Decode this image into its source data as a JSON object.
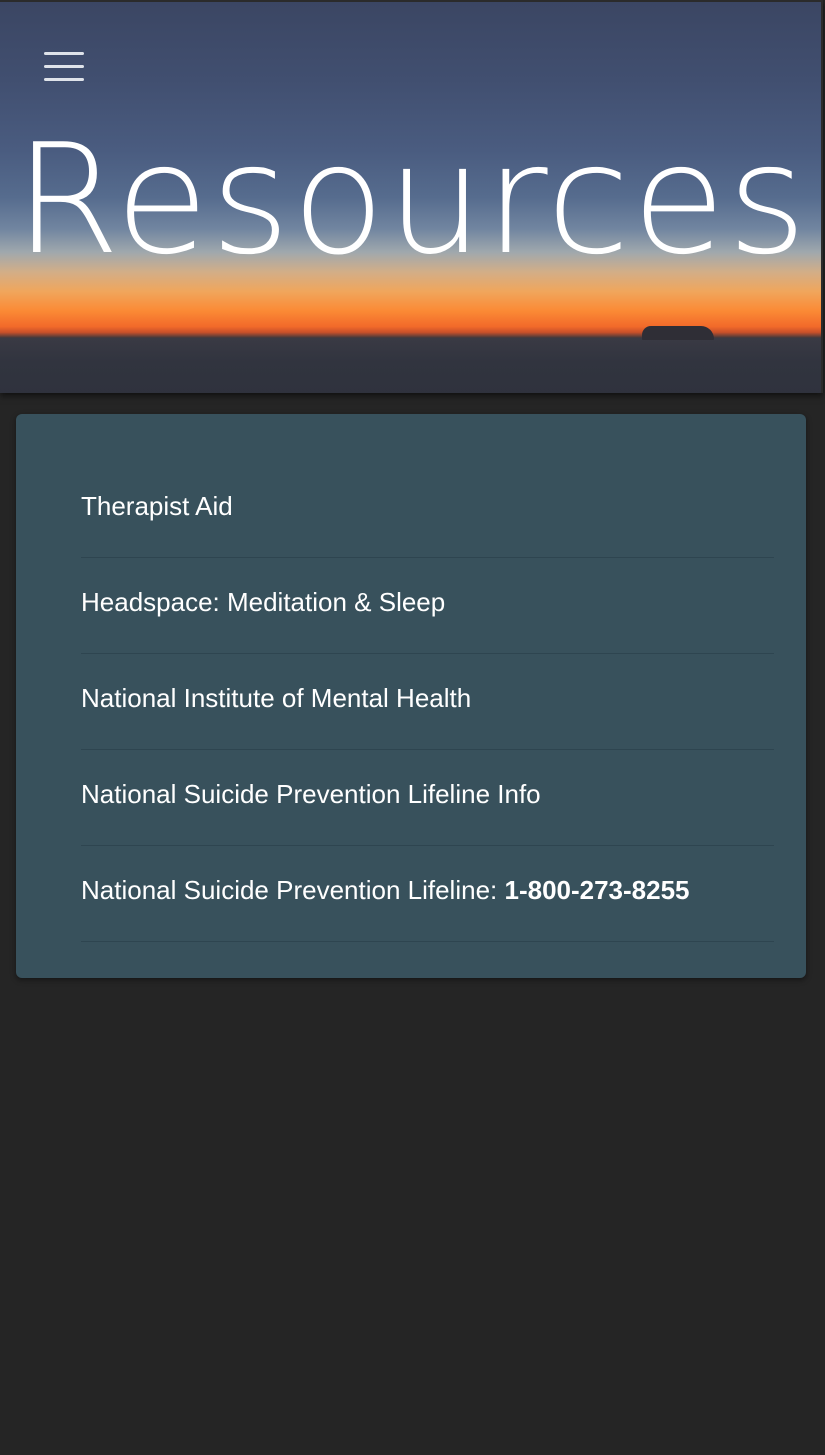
{
  "header": {
    "title": "Resources",
    "menu_icon": "hamburger-menu-icon"
  },
  "resources": {
    "items": [
      {
        "label": "Therapist Aid"
      },
      {
        "label": "Headspace: Meditation & Sleep"
      },
      {
        "label": "National Institute of Mental Health"
      },
      {
        "label": "National Suicide Prevention Lifeline Info"
      },
      {
        "label": "National Suicide Prevention Lifeline: ",
        "phone": "1-800-273-8255"
      }
    ]
  },
  "colors": {
    "page_background": "#252525",
    "card_background": "#38515c",
    "text": "#ffffff",
    "sunset_orange": "#fb8a35",
    "sky_blue": "#4a5c80"
  }
}
